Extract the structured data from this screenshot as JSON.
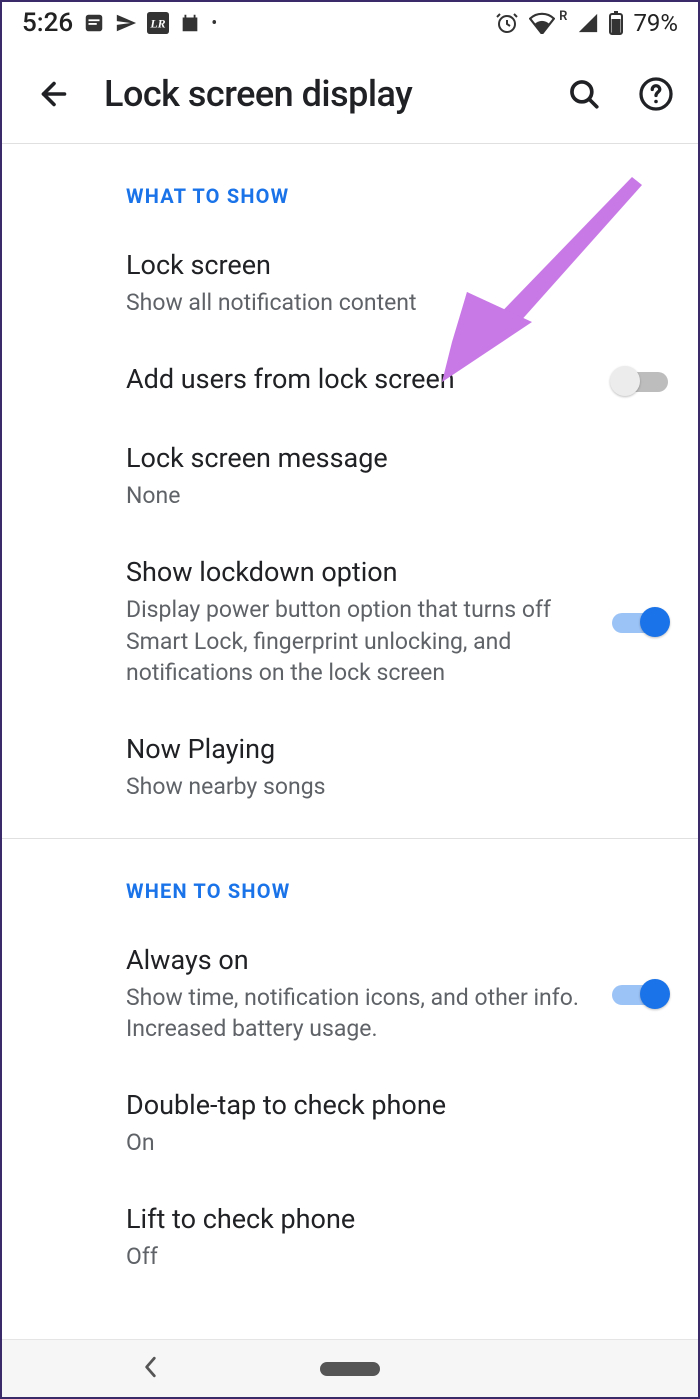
{
  "status": {
    "time": "5:26",
    "battery": "79%",
    "roaming": "R"
  },
  "appbar": {
    "title": "Lock screen display"
  },
  "sections": [
    {
      "header": "WHAT TO SHOW",
      "items": [
        {
          "title": "Lock screen",
          "subtitle": "Show all notification content",
          "toggle": null
        },
        {
          "title": "Add users from lock screen",
          "subtitle": "",
          "toggle": false
        },
        {
          "title": "Lock screen message",
          "subtitle": "None",
          "toggle": null
        },
        {
          "title": "Show lockdown option",
          "subtitle": "Display power button option that turns off Smart Lock, fingerprint unlocking, and notifications on the lock screen",
          "toggle": true
        },
        {
          "title": "Now Playing",
          "subtitle": "Show nearby songs",
          "toggle": null
        }
      ]
    },
    {
      "header": "WHEN TO SHOW",
      "items": [
        {
          "title": "Always on",
          "subtitle": "Show time, notification icons, and other info. Increased battery usage.",
          "toggle": true
        },
        {
          "title": "Double-tap to check phone",
          "subtitle": "On",
          "toggle": null
        },
        {
          "title": "Lift to check phone",
          "subtitle": "Off",
          "toggle": null
        }
      ]
    }
  ],
  "annotation": {
    "arrow_color": "#c879e6"
  }
}
